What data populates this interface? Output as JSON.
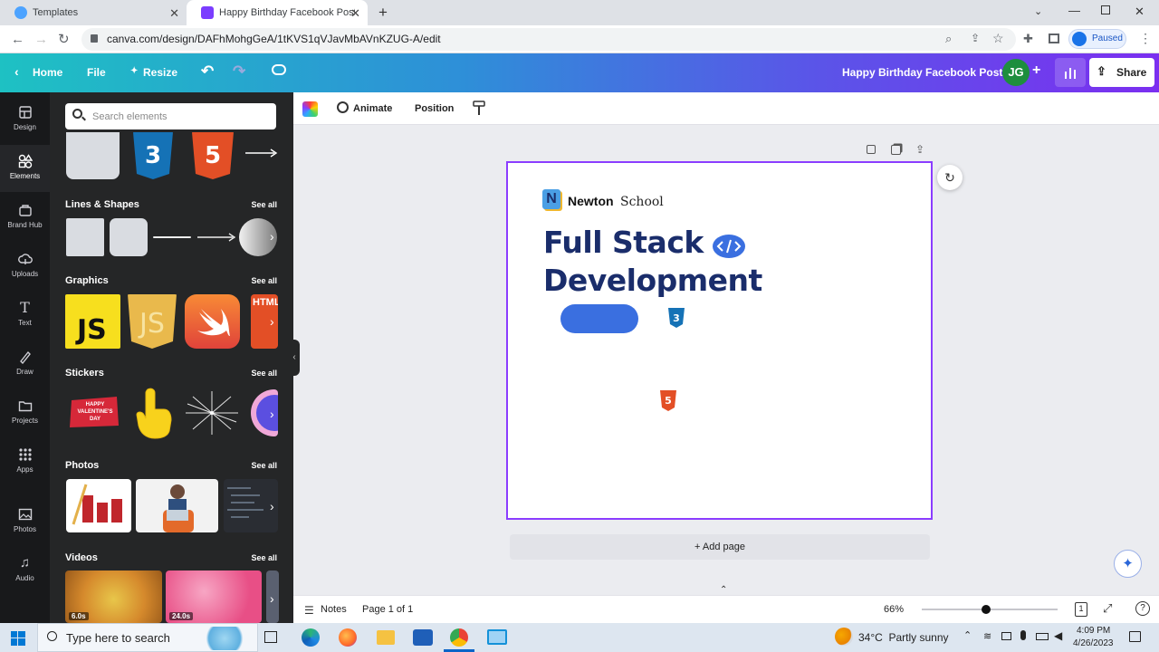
{
  "browser": {
    "tabs": [
      {
        "title": "Templates"
      },
      {
        "title": "Happy Birthday Facebook Post - "
      }
    ],
    "new_tab": "+",
    "url": "canva.com/design/DAFhMohgGeA/1tKVS1qVJavMbAVnKZUG-A/edit",
    "profile_status": "Paused"
  },
  "header": {
    "home": "Home",
    "file": "File",
    "resize": "Resize",
    "doc_title": "Happy Birthday Facebook Post",
    "avatar": "JG",
    "share": "Share"
  },
  "rail": [
    {
      "label": "Design",
      "icon": "design-icon"
    },
    {
      "label": "Elements",
      "icon": "elements-icon"
    },
    {
      "label": "Brand Hub",
      "icon": "brand-hub-icon"
    },
    {
      "label": "Uploads",
      "icon": "uploads-icon"
    },
    {
      "label": "Text",
      "icon": "text-icon"
    },
    {
      "label": "Draw",
      "icon": "draw-icon"
    },
    {
      "label": "Projects",
      "icon": "projects-icon"
    },
    {
      "label": "Apps",
      "icon": "apps-icon"
    },
    {
      "label": "Photos",
      "icon": "photos-icon"
    },
    {
      "label": "Audio",
      "icon": "audio-icon"
    }
  ],
  "panel": {
    "search_placeholder": "Search elements",
    "see_all": "See all",
    "sections": {
      "lines": "Lines & Shapes",
      "graphics": "Graphics",
      "stickers": "Stickers",
      "photos": "Photos",
      "videos": "Videos"
    },
    "graphic_js": "JS",
    "graphic_html": "HTML",
    "sticker_text": "HAPPY VALENTINE'S DAY",
    "video_durations": [
      "6.0s",
      "24.0s"
    ]
  },
  "toolbar": {
    "animate": "Animate",
    "position": "Position"
  },
  "design": {
    "brand_bold": "Newton",
    "brand_light": "School",
    "title_line1": "Full Stack",
    "title_line2": "Development"
  },
  "add_page": "+ Add page",
  "footer": {
    "notes": "Notes",
    "page": "Page 1 of 1",
    "zoom": "66%",
    "zoom_value": 0.66,
    "page_count": "1"
  },
  "taskbar": {
    "search_placeholder": "Type here to search",
    "weather": "34°C  Partly sunny",
    "time": "4:09 PM",
    "date": "4/26/2023"
  },
  "colors": {
    "accent": "#8b3dff",
    "navy": "#1a2d6b",
    "blue_pill": "#3a6fe0"
  }
}
